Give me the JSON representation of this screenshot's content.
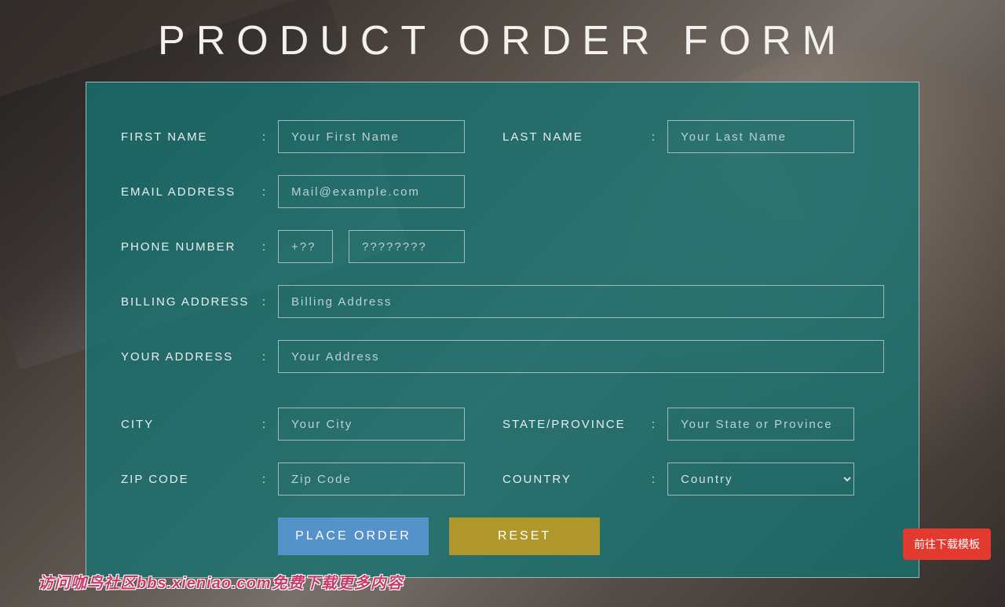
{
  "title": "PRODUCT ORDER FORM",
  "labels": {
    "first_name": "FIRST NAME",
    "last_name": "LAST NAME",
    "email": "EMAIL ADDRESS",
    "phone": "PHONE NUMBER",
    "billing": "BILLING ADDRESS",
    "address": "YOUR ADDRESS",
    "city": "CITY",
    "state": "STATE/PROVINCE",
    "zip": "ZIP CODE",
    "country": "COUNTRY"
  },
  "placeholders": {
    "first_name": "Your First Name",
    "last_name": "Your Last Name",
    "email": "Mail@example.com",
    "phone_cc": "+??",
    "phone_num": "????????",
    "billing": "Billing Address",
    "address": "Your Address",
    "city": "Your City",
    "state": "Your State or Province",
    "zip": "Zip Code"
  },
  "country": {
    "selected": "Country"
  },
  "buttons": {
    "submit": "PLACE ORDER",
    "reset": "RESET"
  },
  "floating_button": "前往下载模板",
  "watermark": "访问咖鸟社区bbs.xieniao.com免费下载更多内容"
}
